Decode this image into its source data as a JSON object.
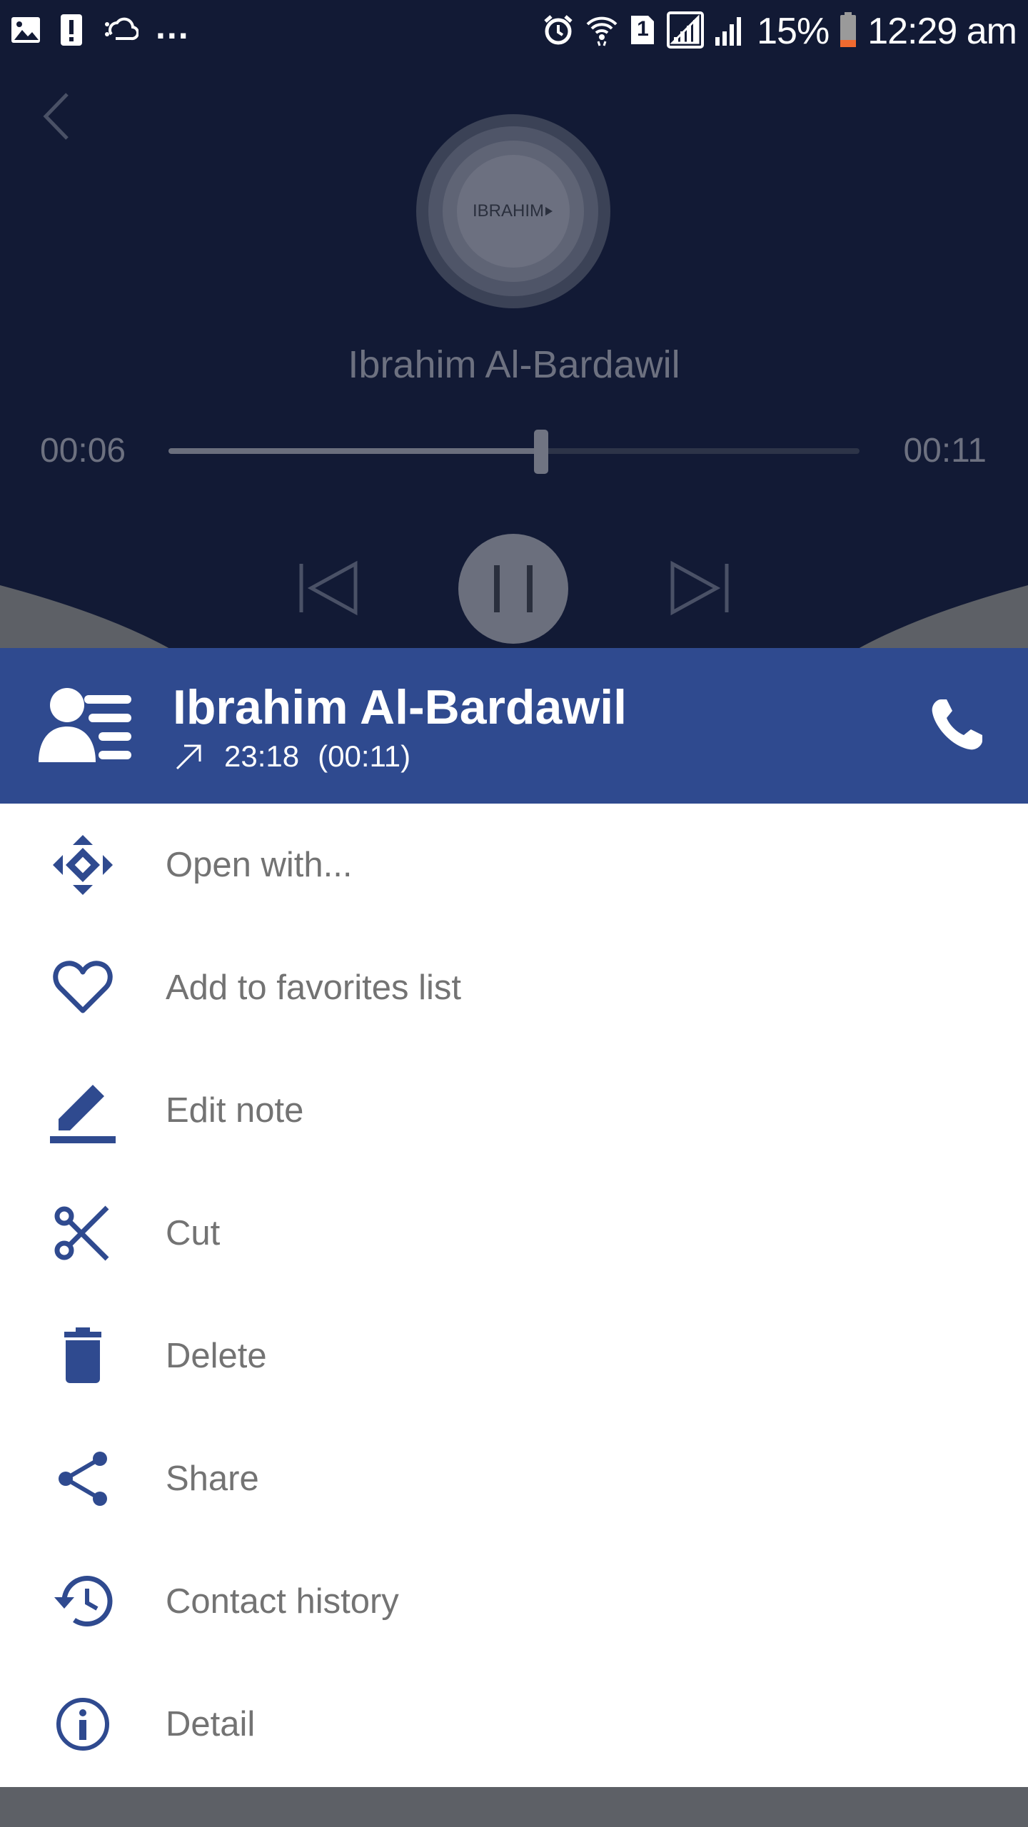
{
  "status_bar": {
    "dots": "...",
    "sim_label": "1",
    "battery_percent": "15%",
    "time": "12:29 am"
  },
  "player": {
    "avatar_text": "IBRAHIM",
    "title": "Ibrahim Al-Bardawil",
    "current_time": "00:06",
    "total_time": "00:11",
    "progress": 0.54
  },
  "contact": {
    "name": "Ibrahim Al-Bardawil",
    "time": "23:18",
    "duration": "(00:11)"
  },
  "menu": {
    "items": [
      {
        "label": "Open with...",
        "icon": "open-with-icon"
      },
      {
        "label": "Add to favorites list",
        "icon": "heart-icon"
      },
      {
        "label": "Edit note",
        "icon": "pencil-icon"
      },
      {
        "label": "Cut",
        "icon": "scissors-icon"
      },
      {
        "label": "Delete",
        "icon": "trash-icon"
      },
      {
        "label": "Share",
        "icon": "share-icon"
      },
      {
        "label": "Contact history",
        "icon": "history-icon"
      },
      {
        "label": "Detail",
        "icon": "info-icon"
      }
    ]
  },
  "colors": {
    "header": "#2f4a8f",
    "icon": "#2f4a8f",
    "player_bg": "#121a35",
    "battery_low": "#f06a30"
  }
}
